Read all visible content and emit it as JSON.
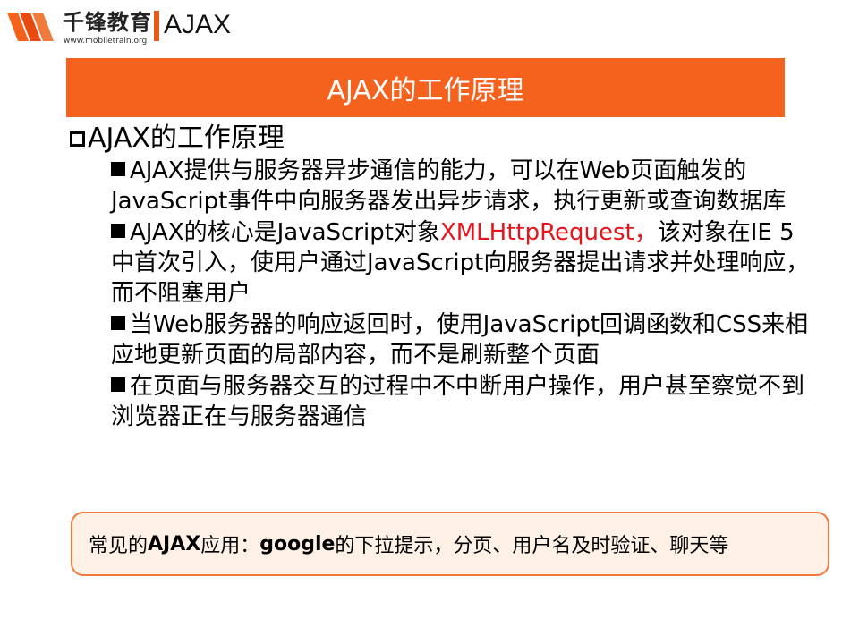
{
  "header": {
    "brand_name": "千锋教育",
    "brand_url": "www.mobiletrain.org",
    "section_title": "AJAX"
  },
  "banner": {
    "title": "AJAX的工作原理"
  },
  "main": {
    "heading": "AJAX的工作原理",
    "bullets": [
      {
        "text": "AJAX提供与服务器异步通信的能力，可以在Web页面触发的JavaScript事件中向服务器发出异步请求，执行更新或查询数据库"
      },
      {
        "before": "AJAX的核心是JavaScript对象",
        "highlight": "XMLHttpRequest，",
        "after": "该对象在IE 5中首次引入，使用户通过JavaScript向服务器提出请求并处理响应，而不阻塞用户"
      },
      {
        "text": "当Web服务器的响应返回时，使用JavaScript回调函数和CSS来相应地更新页面的局部内容，而不是刷新整个页面"
      },
      {
        "text": "在页面与服务器交互的过程中不中断用户操作，用户甚至察觉不到浏览器正在与服务器通信"
      }
    ]
  },
  "callout": {
    "prefix": "常见的",
    "bold": "AJAX",
    "mid": "应用： ",
    "bold2": "google",
    "suffix": "的下拉提示，分页、用户名及时验证、聊天等"
  },
  "colors": {
    "accent": "#f5621e",
    "highlight": "#e8141b",
    "callout_border": "#f07a3a",
    "callout_bg": "#fff1e6"
  }
}
